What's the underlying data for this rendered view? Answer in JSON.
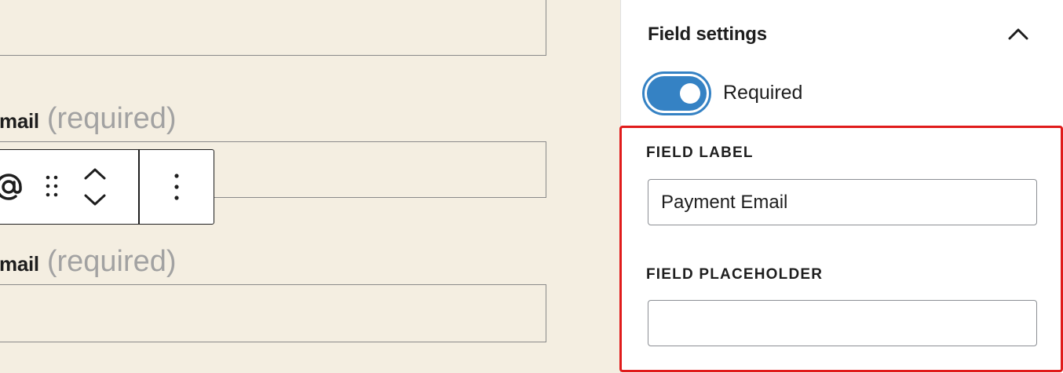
{
  "canvas": {
    "fields": [
      {
        "name": "mail",
        "required_text": "(required)"
      },
      {
        "name": "mail",
        "required_text": "(required)"
      }
    ],
    "toolbar": {
      "block_icon": "at-sign-icon",
      "drag_icon": "drag-handle-icon",
      "move_icons": [
        "chevron-up-icon",
        "chevron-down-icon"
      ],
      "more_icon": "more-vertical-icon"
    }
  },
  "sidebar": {
    "panel_title": "Field settings",
    "collapse_icon": "chevron-up-icon",
    "required_toggle": {
      "label": "Required",
      "checked": true
    },
    "field_label": {
      "title": "FIELD LABEL",
      "value": "Payment Email"
    },
    "field_placeholder": {
      "title": "FIELD PLACEHOLDER",
      "value": ""
    }
  },
  "colors": {
    "canvas_bg": "#f4eee1",
    "accent": "#3582c4",
    "highlight": "#e01b1b",
    "muted_text": "#a2a2a2"
  }
}
